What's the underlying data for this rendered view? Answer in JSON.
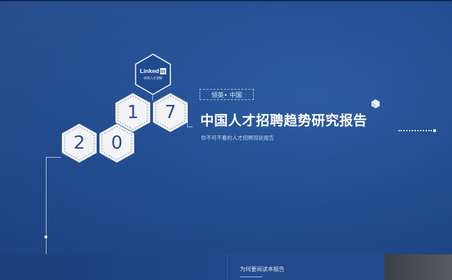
{
  "logo": {
    "brand_text": "Linked",
    "brand_in": "in",
    "caption": "领英人才洞察"
  },
  "year_digits": [
    "2",
    "0",
    "1",
    "7"
  ],
  "tag_label": "领英• 中国",
  "title": "中国人才招聘趋势研究报告",
  "subtitle": "你不可不看的人才招聘现状报告",
  "bottom_nav": {
    "label": "为何要阅读本报告"
  },
  "colors": {
    "background": "#234e92",
    "hex_fill": "#f2f4f8",
    "digit": "#2b4e8c",
    "logo_hex": "#1f4a8e"
  }
}
